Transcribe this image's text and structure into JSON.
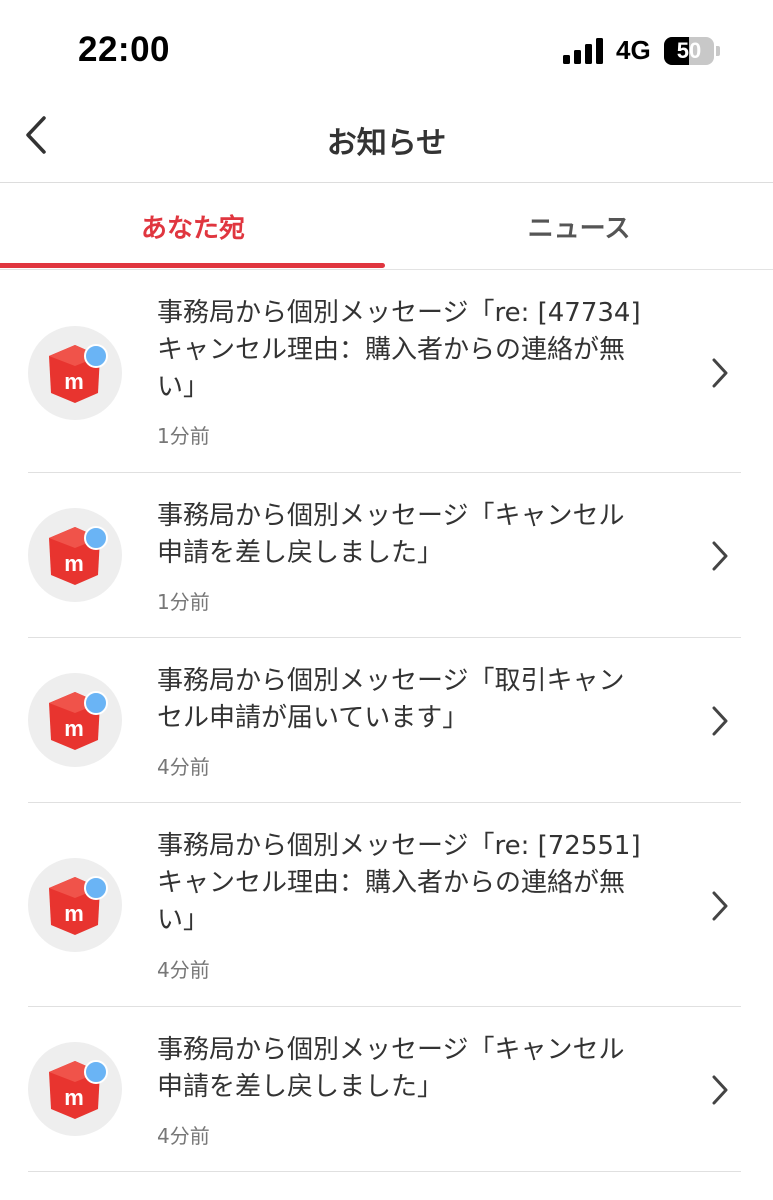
{
  "status_bar": {
    "time": "22:00",
    "network": "4G",
    "battery": "50",
    "battery_level": 0.5
  },
  "header": {
    "title": "お知らせ",
    "back_icon": "chevron-left-icon"
  },
  "tabs": [
    {
      "label": "あなた宛",
      "active": true
    },
    {
      "label": "ニュース",
      "active": false
    }
  ],
  "colors": {
    "accent": "#e0363f",
    "logo_red": "#e8342f",
    "unread_dot": "#6ab4f5"
  },
  "notifications": [
    {
      "message": "事務局から個別メッセージ「re: [47734]\nキャンセル理由：購入者からの連絡が無\nい」",
      "time": "1分前",
      "icon": "mercari-logo-icon"
    },
    {
      "message": "事務局から個別メッセージ「キャンセル\n申請を差し戻しました」",
      "time": "1分前",
      "icon": "mercari-logo-icon"
    },
    {
      "message": "事務局から個別メッセージ「取引キャン\nセル申請が届いています」",
      "time": "4分前",
      "icon": "mercari-logo-icon"
    },
    {
      "message": "事務局から個別メッセージ「re: [72551]\nキャンセル理由：購入者からの連絡が無\nい」",
      "time": "4分前",
      "icon": "mercari-logo-icon"
    },
    {
      "message": "事務局から個別メッセージ「キャンセル\n申請を差し戻しました」",
      "time": "4分前",
      "icon": "mercari-logo-icon"
    }
  ]
}
